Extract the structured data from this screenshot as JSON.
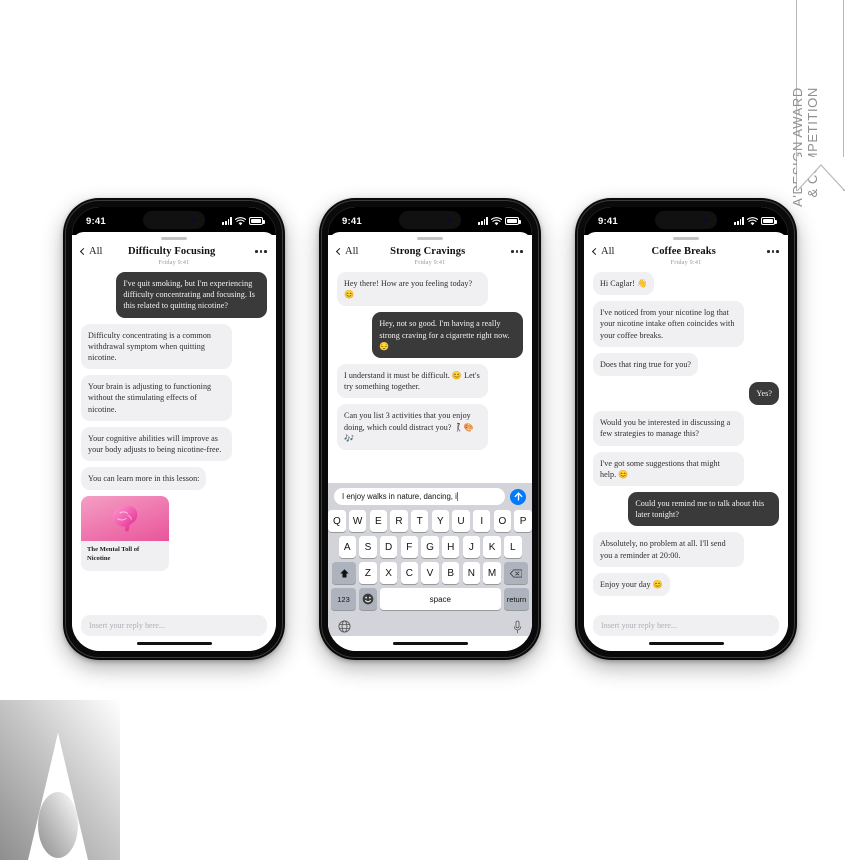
{
  "award_ribbon": {
    "line1": "A'DESIGN AWARD",
    "line2": "& COMPETITION"
  },
  "status_bar": {
    "time": "9:41",
    "icons": [
      "signal-bars-icon",
      "wifi-icon",
      "battery-icon"
    ]
  },
  "common": {
    "back_label": "All",
    "datestamp": "Friday 9:41",
    "composer_placeholder": "Insert your reply here...",
    "accent_send": "#007aff",
    "bubble_in_bg": "#f0eff2",
    "bubble_out_bg": "#3a3a3a"
  },
  "phones": [
    {
      "id": "phone-1",
      "title": "Difficulty Focusing",
      "messages": [
        {
          "side": "out",
          "text": "I've quit smoking, but I'm experiencing difficulty concentrating and focusing. Is this related to quitting nicotine?"
        },
        {
          "side": "in",
          "text": "Difficulty concentrating is a common withdrawal symptom when quitting nicotine."
        },
        {
          "side": "in",
          "text": "Your brain is adjusting to functioning without the stimulating effects of nicotine."
        },
        {
          "side": "in",
          "text": "Your cognitive abilities will improve as your body adjusts to being nicotine-free."
        },
        {
          "side": "in",
          "text": "You can learn more in this lesson:"
        }
      ],
      "lesson_card": {
        "title": "The Mental Toll of Nicotine",
        "image": "brain-illustration",
        "gradient_from": "#f4a0c5",
        "gradient_to": "#e8559b"
      },
      "has_keyboard": false
    },
    {
      "id": "phone-2",
      "title": "Strong Cravings",
      "messages": [
        {
          "side": "in",
          "text": "Hey there! How are you feeling today? 😊"
        },
        {
          "side": "out",
          "text": "Hey, not so good. I'm having a really strong craving for a cigarette right now. 😔"
        },
        {
          "side": "in",
          "text": "I understand it must be difficult. 😊 Let's try something together."
        },
        {
          "side": "in",
          "text": "Can you list 3 activities that you enjoy doing, which could distract you? 🚶‍♀️🎨🎶"
        }
      ],
      "has_keyboard": true,
      "keyboard": {
        "input_value": "I enjoy walks in nature, dancing, i",
        "send_icon": "arrow-up-icon",
        "row1": [
          "Q",
          "W",
          "E",
          "R",
          "T",
          "Y",
          "U",
          "I",
          "O",
          "P"
        ],
        "row2": [
          "A",
          "S",
          "D",
          "F",
          "G",
          "H",
          "J",
          "K",
          "L"
        ],
        "row3_shift": "shift-icon",
        "row3": [
          "Z",
          "X",
          "C",
          "V",
          "B",
          "N",
          "M"
        ],
        "row3_backspace": "backspace-icon",
        "numbers_key": "123",
        "emoji_key": "emoji-icon",
        "space_key": "space",
        "return_key": "return",
        "globe_key": "globe-icon",
        "mic_key": "microphone-icon"
      }
    },
    {
      "id": "phone-3",
      "title": "Coffee Breaks",
      "messages": [
        {
          "side": "in",
          "text": "Hi Caglar! 👋"
        },
        {
          "side": "in",
          "text": "I've noticed from your nicotine log that your nicotine intake often coincides with your coffee breaks."
        },
        {
          "side": "in",
          "text": "Does that ring true for you?"
        },
        {
          "side": "out",
          "text": "Yes?"
        },
        {
          "side": "in",
          "text": "Would you be interested in discussing a few strategies to manage this?"
        },
        {
          "side": "in",
          "text": " I've got some suggestions that might help. 😊"
        },
        {
          "side": "out",
          "text": "Could you remind me to talk about this later tonight?"
        },
        {
          "side": "in",
          "text": "Absolutely, no problem at all. I'll send you a reminder at 20:00."
        },
        {
          "side": "in",
          "text": "Enjoy your day 😊"
        }
      ],
      "has_keyboard": false
    }
  ]
}
